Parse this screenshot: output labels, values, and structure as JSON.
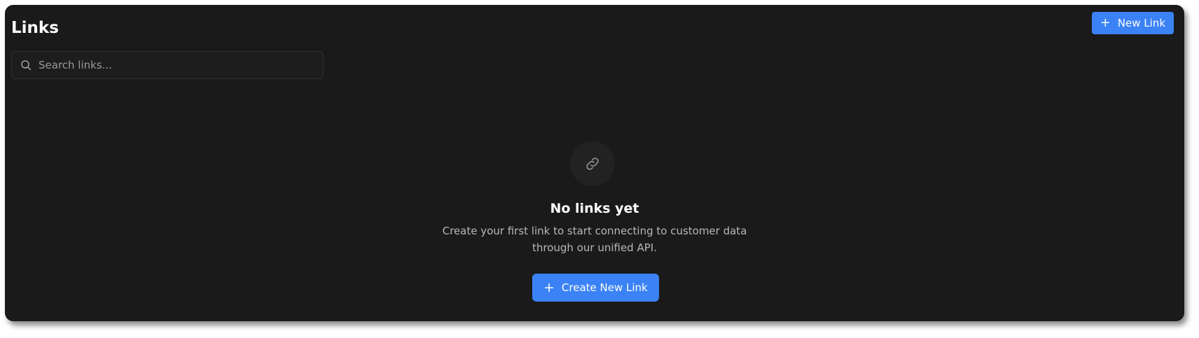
{
  "header": {
    "title": "Links",
    "new_link_label": "New Link",
    "new_link_icon": "plus-icon"
  },
  "search": {
    "placeholder": "Search links...",
    "value": "",
    "icon": "search-icon"
  },
  "empty_state": {
    "icon": "link-icon",
    "title": "No links yet",
    "description": "Create your first link to start connecting to customer data through our unified API.",
    "cta_label": "Create New Link",
    "cta_icon": "plus-icon"
  },
  "colors": {
    "background": "#1a1a1a",
    "accent": "#3b82f6",
    "text": "#ffffff",
    "muted_text": "#b8b8b8"
  }
}
